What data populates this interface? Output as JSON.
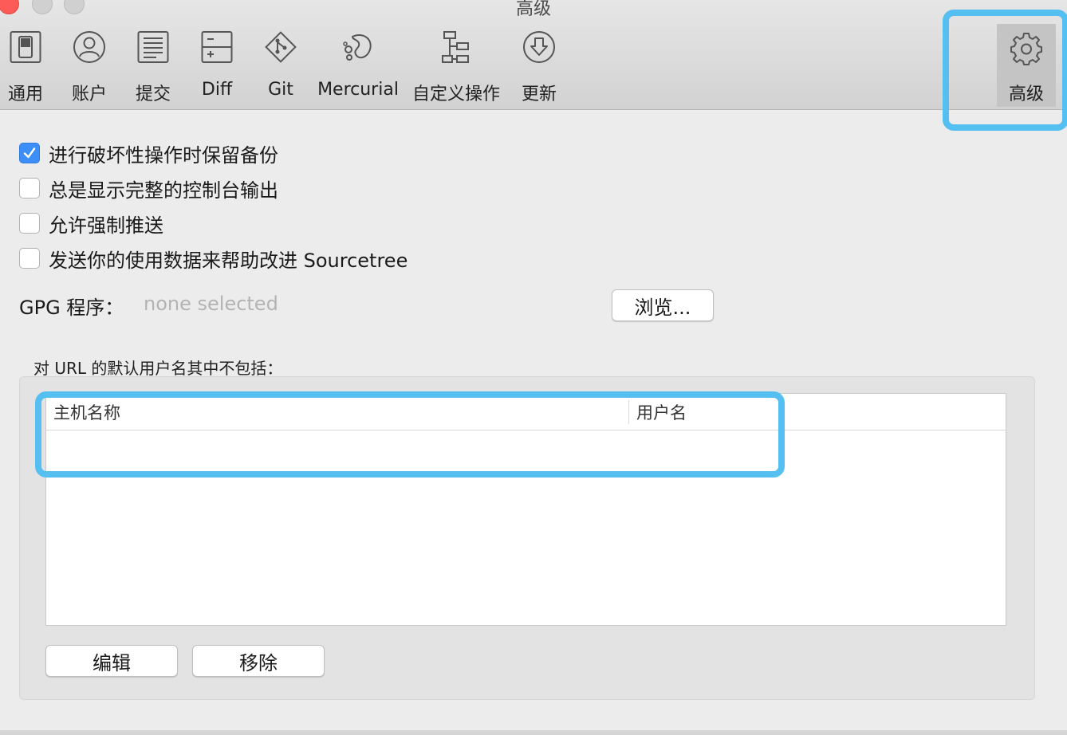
{
  "window": {
    "title": "高级"
  },
  "toolbar": {
    "items": [
      {
        "label": "通用",
        "icon": "general-switch-icon"
      },
      {
        "label": "账户",
        "icon": "account-user-icon"
      },
      {
        "label": "提交",
        "icon": "commit-document-icon"
      },
      {
        "label": "Diff",
        "icon": "diff-plus-minus-icon"
      },
      {
        "label": "Git",
        "icon": "git-branch-icon"
      },
      {
        "label": "Mercurial",
        "icon": "mercurial-icon"
      },
      {
        "label": "自定义操作",
        "icon": "custom-actions-icon"
      },
      {
        "label": "更新",
        "icon": "update-download-icon"
      },
      {
        "label": "高级",
        "icon": "gear-icon",
        "active": true
      }
    ]
  },
  "options": [
    {
      "label": "进行破坏性操作时保留备份",
      "checked": true
    },
    {
      "label": "总是显示完整的控制台输出",
      "checked": false
    },
    {
      "label": "允许强制推送",
      "checked": false
    },
    {
      "label": "发送你的使用数据来帮助改进 Sourcetree",
      "checked": false
    }
  ],
  "gpg": {
    "label": "GPG 程序：",
    "value": "none selected",
    "browse_label": "浏览..."
  },
  "url_exclusions": {
    "title": "对 URL 的默认用户名其中不包括：",
    "columns": [
      "主机名称",
      "用户名"
    ],
    "rows": [],
    "edit_label": "编辑",
    "remove_label": "移除"
  },
  "colors": {
    "highlight": "#55bff1",
    "checkbox_accent": "#3d8ef7"
  }
}
